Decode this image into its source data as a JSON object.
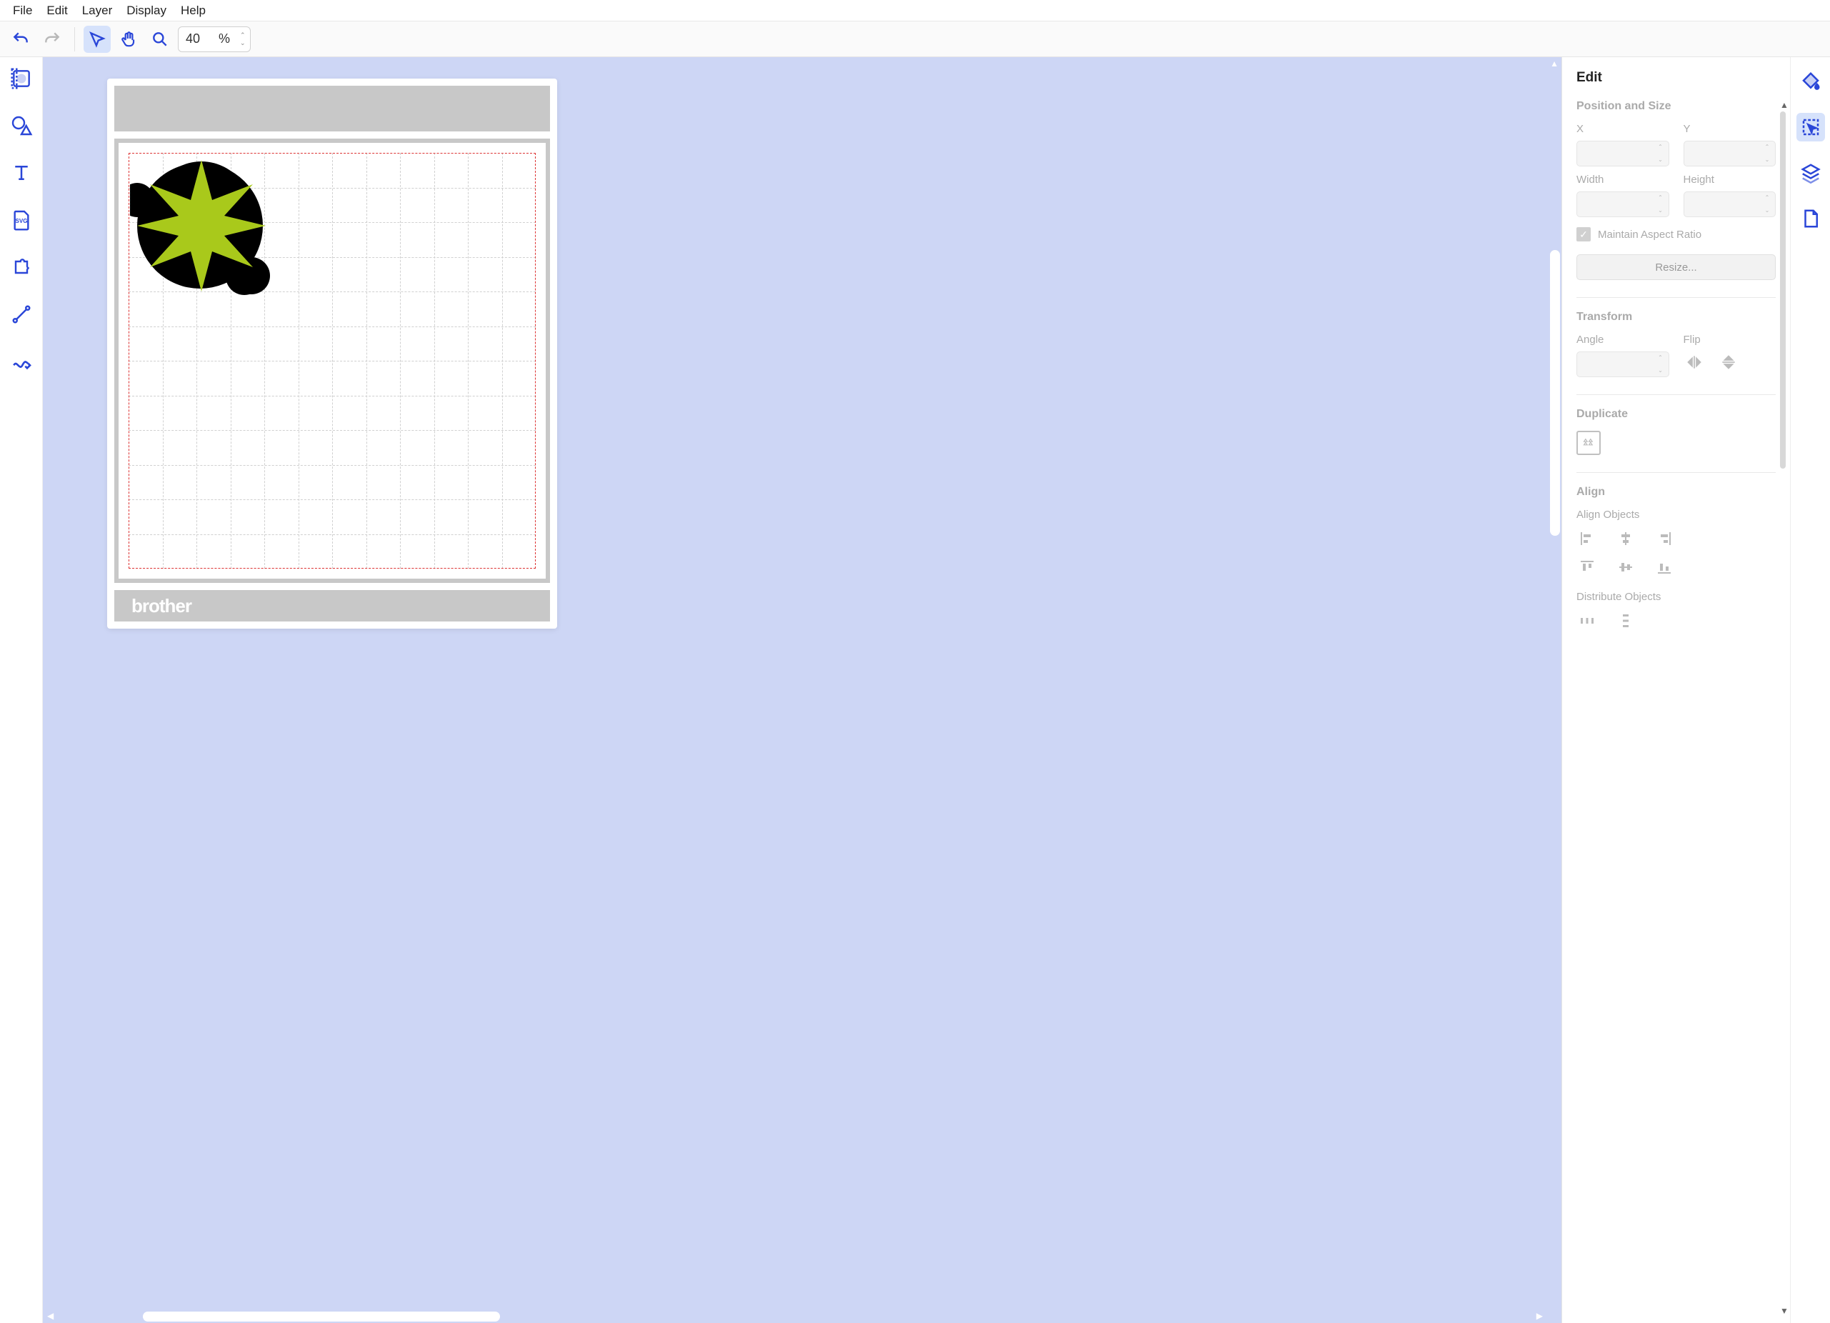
{
  "menubar": {
    "items": [
      "File",
      "Edit",
      "Layer",
      "Display",
      "Help"
    ]
  },
  "toolbar": {
    "zoom_value": "40",
    "zoom_unit": "%"
  },
  "canvas": {
    "brand": "brother"
  },
  "panel": {
    "title": "Edit",
    "pos_size": {
      "heading": "Position and Size",
      "x_label": "X",
      "y_label": "Y",
      "w_label": "Width",
      "h_label": "Height",
      "aspect_label": "Maintain Aspect Ratio",
      "resize_label": "Resize..."
    },
    "transform": {
      "heading": "Transform",
      "angle_label": "Angle",
      "flip_label": "Flip"
    },
    "duplicate": {
      "heading": "Duplicate"
    },
    "align": {
      "heading": "Align",
      "objects_label": "Align Objects",
      "distribute_label": "Distribute Objects"
    }
  }
}
